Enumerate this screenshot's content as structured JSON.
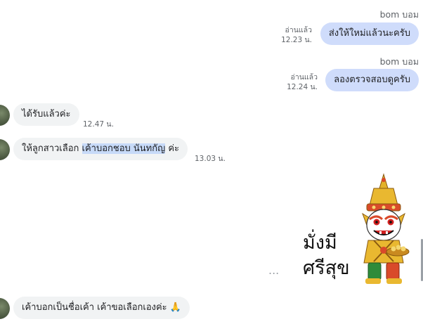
{
  "messages": [
    {
      "sender": "bom บอม",
      "text": "ส่งให้ใหม่แล้วนะครับ",
      "status": "อ่านแล้ว",
      "time": "12.23 น."
    },
    {
      "sender": "bom บอม",
      "text": "ลองตรวจสอบดูครับ",
      "status": "อ่านแล้ว",
      "time": "12.24 น."
    },
    {
      "text": "ได้รับแล้วค่ะ",
      "time": "12.47 น."
    },
    {
      "text_before": "ให้ลูกสาวเลือก ",
      "text_highlight": "เค้าบอกชอบ นันทกัญ",
      "text_after": " ค่ะ",
      "time": "13.03 น."
    },
    {
      "text": "เค้าบอกเป็นชื่อเค้า เค้าขอเลือกเองค่ะ 🙏",
      "time": ""
    }
  ],
  "sticker": {
    "line1": "มั่งมี",
    "line2": "ศรีสุข",
    "more_label": "..."
  },
  "colors": {
    "outgoing_bubble": "#cfdcfb",
    "incoming_bubble": "#f1f3f4",
    "highlight": "#c7daf8"
  }
}
